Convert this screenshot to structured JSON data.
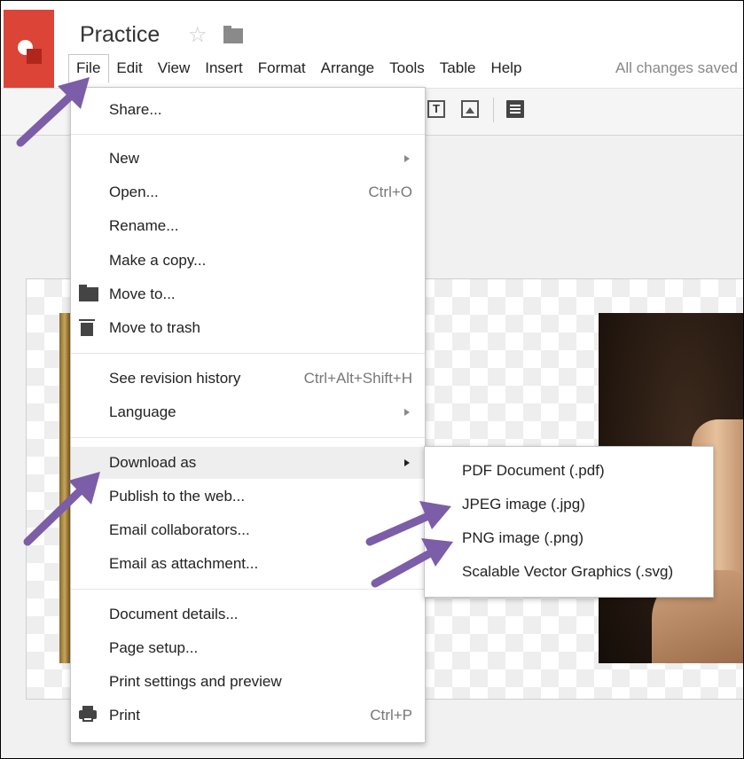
{
  "app": {
    "doc_title": "Practice",
    "status": "All changes saved"
  },
  "menubar": {
    "items": [
      "File",
      "Edit",
      "View",
      "Insert",
      "Format",
      "Arrange",
      "Tools",
      "Table",
      "Help"
    ]
  },
  "file_menu": {
    "share": "Share...",
    "new": "New",
    "open": "Open...",
    "open_shortcut": "Ctrl+O",
    "rename": "Rename...",
    "make_copy": "Make a copy...",
    "move_to": "Move to...",
    "move_to_trash": "Move to trash",
    "revision_history": "See revision history",
    "revision_shortcut": "Ctrl+Alt+Shift+H",
    "language": "Language",
    "download_as": "Download as",
    "publish": "Publish to the web...",
    "email_collaborators": "Email collaborators...",
    "email_attachment": "Email as attachment...",
    "document_details": "Document details...",
    "page_setup": "Page setup...",
    "print_settings": "Print settings and preview",
    "print": "Print",
    "print_shortcut": "Ctrl+P"
  },
  "download_submenu": {
    "pdf": "PDF Document (.pdf)",
    "jpg": "JPEG image (.jpg)",
    "png": "PNG image (.png)",
    "svg": "Scalable Vector Graphics (.svg)"
  },
  "toolbar": {
    "text_icon_glyph": "T"
  },
  "colors": {
    "brand_red": "#db4437",
    "annotation_arrow": "#7b5ea7"
  }
}
